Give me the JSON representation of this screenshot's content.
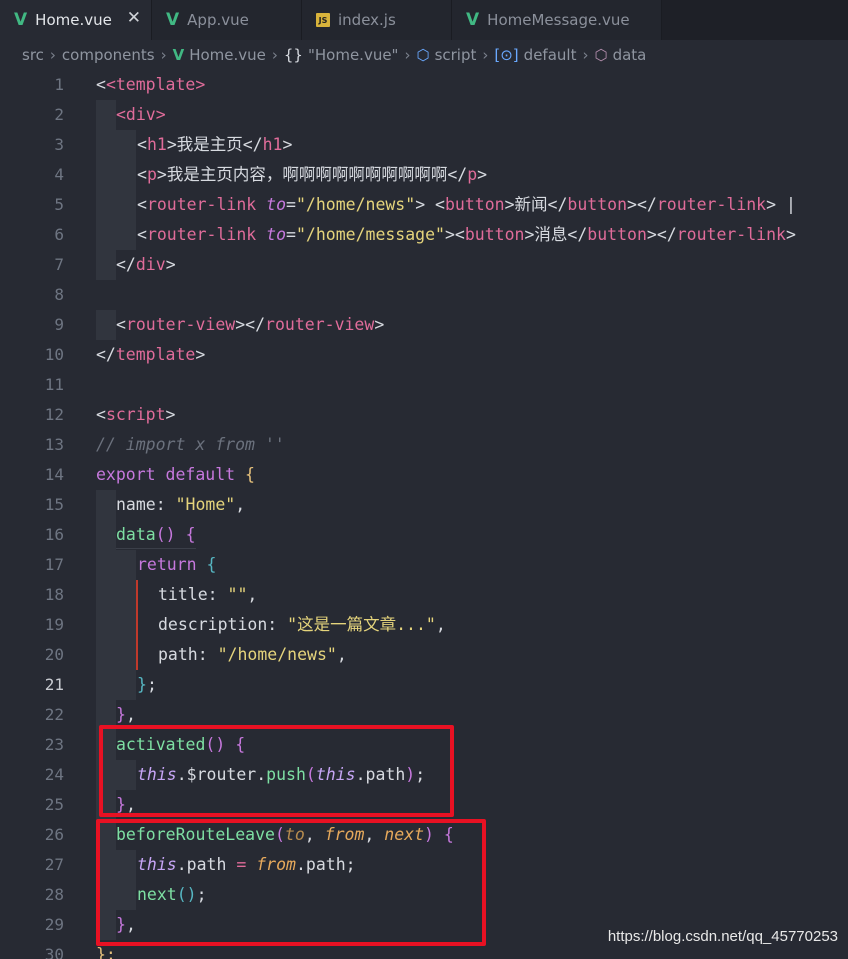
{
  "tabs": [
    {
      "label": "Home.vue",
      "icon": "vue-icon",
      "active": true
    },
    {
      "label": "App.vue",
      "icon": "vue-icon",
      "active": false
    },
    {
      "label": "index.js",
      "icon": "js-icon",
      "active": false
    },
    {
      "label": "HomeMessage.vue",
      "icon": "vue-icon",
      "active": false
    }
  ],
  "tab_close_glyph": "✕",
  "js_icon_text": "JS",
  "breadcrumb": {
    "items": [
      "src",
      "components",
      "Home.vue",
      "\"Home.vue\"",
      "script",
      "default",
      "data"
    ],
    "icons": [
      "",
      "",
      "vue-icon",
      "braces-icon",
      "cube-icon",
      "bracket-symbol-icon",
      "cube-icon"
    ]
  },
  "line_numbers": [
    "1",
    "2",
    "3",
    "4",
    "5",
    "6",
    "7",
    "8",
    "9",
    "10",
    "11",
    "12",
    "13",
    "14",
    "15",
    "16",
    "17",
    "18",
    "19",
    "20",
    "21",
    "22",
    "23",
    "24",
    "25",
    "26",
    "27",
    "28",
    "29",
    "30"
  ],
  "current_line": "21",
  "code": {
    "l1": "<template>",
    "l2": "<div>",
    "l3_tag_open": "h1",
    "l3_text": "我是主页",
    "l3_tag_close": "h1",
    "l4_tag": "p",
    "l4_text": "我是主页内容，啊啊啊啊啊啊啊啊啊啊",
    "l5_tag": "router-link",
    "l5_attr": "to",
    "l5_val": "\"/home/news\"",
    "l5_btn": "button",
    "l5_text": "新闻",
    "l5_pipe": " |",
    "l6_tag": "router-link",
    "l6_attr": "to",
    "l6_val": "\"/home/message\"",
    "l6_btn": "button",
    "l6_text": "消息",
    "l7": "div",
    "l9": "router-view",
    "l10": "template",
    "l12": "script",
    "l13": "// import x from ''",
    "l14_kw1": "export",
    "l14_kw2": "default",
    "l15_key": "name",
    "l15_val": "\"Home\"",
    "l16_fn": "data",
    "l17_kw": "return",
    "l18_key": "title",
    "l18_val": "\"\"",
    "l19_key": "description",
    "l19_val": "\"这是一篇文章...\"",
    "l20_key": "path",
    "l20_val": "\"/home/news\"",
    "l23_fn": "activated",
    "l24_this": "this",
    "l24_router": ".$router.",
    "l24_push": "push",
    "l24_this2": "this",
    "l24_path": ".path",
    "l26_fn": "beforeRouteLeave",
    "l26_p1": "to",
    "l26_p2": "from",
    "l26_p3": "next",
    "l27_this": "this",
    "l27_path": ".path",
    "l27_from": "from",
    "l27_path2": ".path;",
    "l28_fn": "next",
    "l30": "};"
  },
  "watermark": "https://blog.csdn.net/qq_45770253",
  "colors": {
    "background": "#272a33",
    "tag": "#e06c9a",
    "string": "#e5d47c",
    "function": "#7ee0a3",
    "highlight_box": "#e81123"
  }
}
